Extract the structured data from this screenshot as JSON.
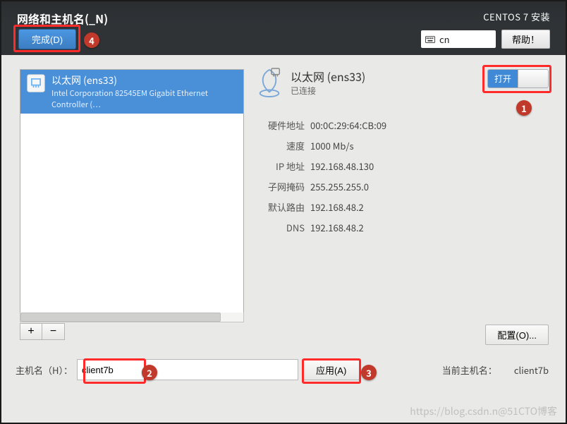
{
  "header": {
    "title": "网络和主机名(_N)",
    "done": "完成(D)",
    "install": "CENTOS 7 安装",
    "keyboard": "cn",
    "help": "帮助！"
  },
  "interface_list": {
    "items": [
      {
        "name": "以太网 (ens33)",
        "detail": "Intel Corporation 82545EM Gigabit Ethernet Controller (…"
      }
    ],
    "add": "+",
    "remove": "−"
  },
  "connection": {
    "title": "以太网 (ens33)",
    "status": "已连接",
    "toggle_on_label": "打开"
  },
  "properties": {
    "hwaddr_label": "硬件地址",
    "hwaddr": "00:0C:29:64:CB:09",
    "speed_label": "速度",
    "speed": "1000 Mb/s",
    "ip_label": "IP 地址",
    "ip": "192.168.48.130",
    "mask_label": "子网掩码",
    "mask": "255.255.255.0",
    "gw_label": "默认路由",
    "gw": "192.168.48.2",
    "dns_label": "DNS",
    "dns": "192.168.48.2"
  },
  "config_button": "配置(O)...",
  "hostname": {
    "label": "主机名（H）：",
    "value": "client7b",
    "apply": "应用(A)",
    "current_label": "当前主机名：",
    "current_value": "client7b"
  },
  "callouts": {
    "1": "1",
    "2": "2",
    "3": "3",
    "4": "4"
  },
  "watermark": "https://blog.csdn.n@51CTO博客"
}
